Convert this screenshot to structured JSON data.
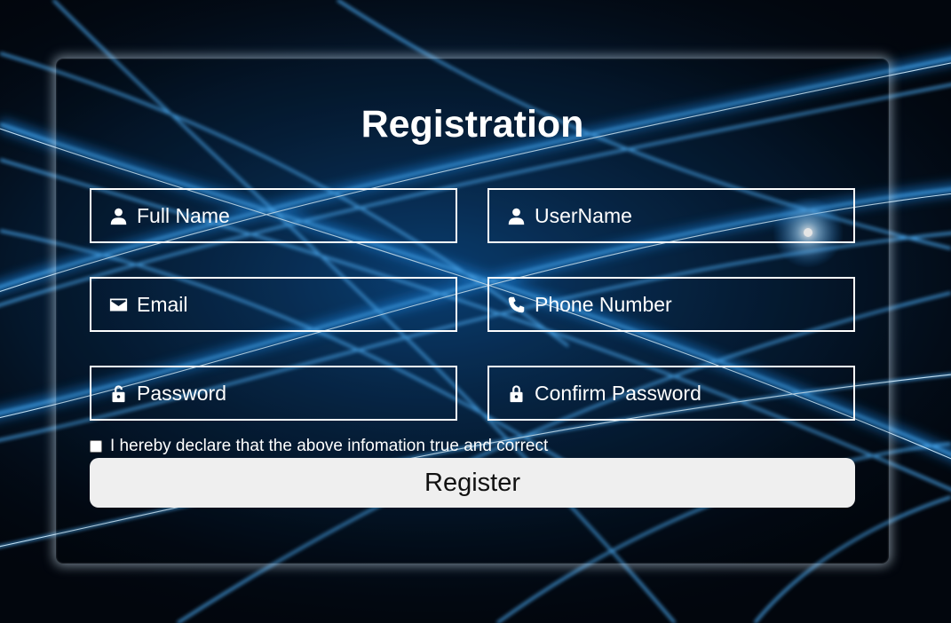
{
  "form": {
    "title": "Registration",
    "fields": [
      {
        "placeholder": "Full Name",
        "icon": "user-icon"
      },
      {
        "placeholder": "UserName",
        "icon": "user-icon"
      },
      {
        "placeholder": "Email",
        "icon": "envelope-icon"
      },
      {
        "placeholder": "Phone Number",
        "icon": "phone-icon"
      },
      {
        "placeholder": "Password",
        "icon": "unlock-icon"
      },
      {
        "placeholder": "Confirm Password",
        "icon": "lock-icon"
      }
    ],
    "declaration": "I hereby declare that the above infomation true and correct",
    "declaration_checked": false,
    "submit_label": "Register"
  },
  "colors": {
    "background": "#02060d",
    "streak": "#1e8ff0",
    "text": "#ffffff",
    "button": "#efefef"
  }
}
